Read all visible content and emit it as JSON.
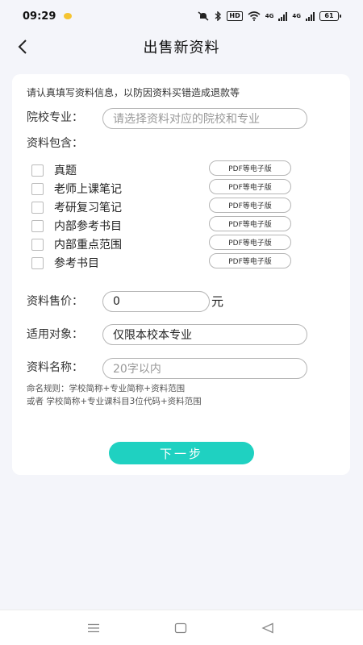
{
  "status": {
    "time": "09:29",
    "hd": "HD",
    "net1": "4G",
    "net2": "4G",
    "battery": "61"
  },
  "header": {
    "title": "出售新资料"
  },
  "form": {
    "notice": "请认真填写资料信息，以防因资料买错造成退款等",
    "school_label": "院校专业：",
    "school_placeholder": "请选择资料对应的院校和专业",
    "contains_label": "资料包含：",
    "items": [
      {
        "label": "真题",
        "format": "PDF等电子版"
      },
      {
        "label": "老师上课笔记",
        "format": "PDF等电子版"
      },
      {
        "label": "考研复习笔记",
        "format": "PDF等电子版"
      },
      {
        "label": "内部参考书目",
        "format": "PDF等电子版"
      },
      {
        "label": "内部重点范围",
        "format": "PDF等电子版"
      },
      {
        "label": "参考书目",
        "format": "PDF等电子版"
      }
    ],
    "price_label": "资料售价：",
    "price_value": "0",
    "price_unit": "元",
    "target_label": "适用对象：",
    "target_value": "仅限本校本专业",
    "name_label": "资料名称：",
    "name_placeholder": "20字以内",
    "rule_line1": "命名规则：学校简称+专业简称+资料范围",
    "rule_line2": "或者 学校简称+专业课科目3位代码+资料范围",
    "next_label": "下一步"
  },
  "colors": {
    "accent": "#1fd1c1",
    "background": "#f4f5fa",
    "card": "#ffffff"
  }
}
